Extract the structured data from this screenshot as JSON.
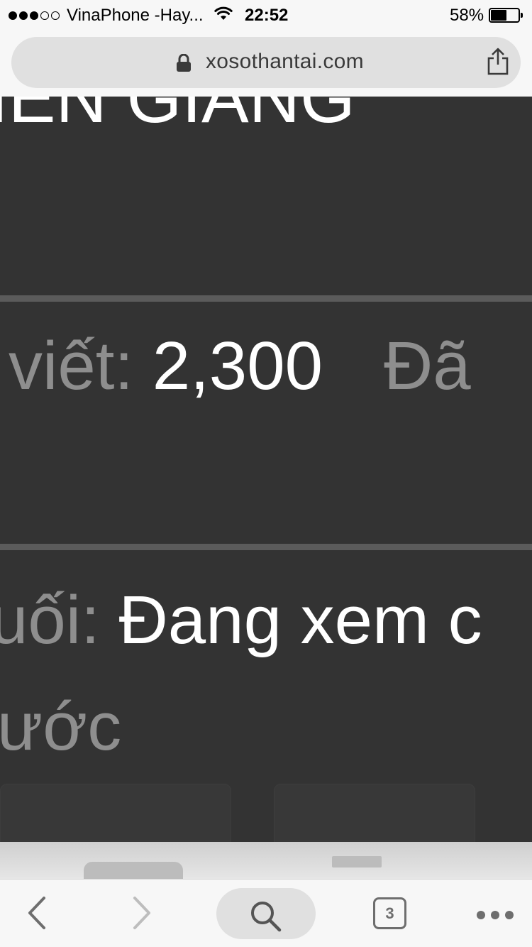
{
  "status_bar": {
    "carrier": "VinaPhone -Hay...",
    "time": "22:52",
    "battery_percent": "58%",
    "battery_level": 0.58,
    "signal_bars_on": 3,
    "signal_bars_total": 5
  },
  "address_bar": {
    "url": "xosothantai.com",
    "lock_icon": "lock-icon",
    "share_icon": "share-icon"
  },
  "page": {
    "province_heading": "IÊN GIANG",
    "posts_row": {
      "label": "viết:",
      "value": "2,300",
      "trailing": "Đã"
    },
    "last_row": {
      "label": "uối:",
      "value": "Đang xem c",
      "continuation": "ước"
    }
  },
  "toolbar": {
    "back_icon": "chevron-left-icon",
    "forward_icon": "chevron-right-icon",
    "search_icon": "search-icon",
    "tab_count": "3",
    "more_icon": "more-dots-icon"
  },
  "colors": {
    "page_bg": "#333333",
    "muted_text": "#8e8e8e",
    "bright_text": "#ffffff",
    "divider": "#5b5b5b",
    "chrome_bg": "#f7f7f7"
  }
}
